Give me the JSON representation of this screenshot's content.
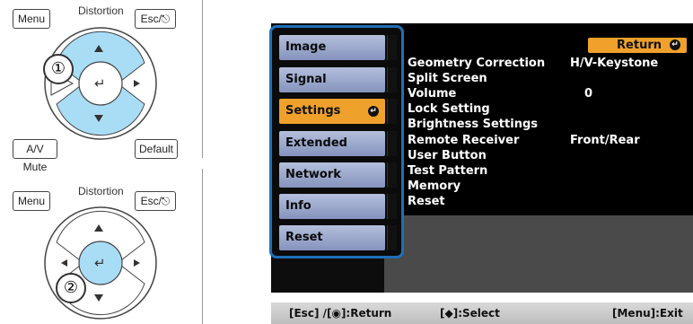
{
  "remote": {
    "menu_label": "Menu",
    "distortion_label": "Distortion",
    "esc_label": "Esc/⎋",
    "av_mute_label": "A/V Mute",
    "default_label": "Default",
    "step1": "①",
    "step2": "②"
  },
  "menu": {
    "items": [
      {
        "label": "Image"
      },
      {
        "label": "Signal"
      },
      {
        "label": "Settings"
      },
      {
        "label": "Extended"
      },
      {
        "label": "Network"
      },
      {
        "label": "Info"
      },
      {
        "label": "Reset"
      }
    ],
    "return_label": "Return",
    "settings": [
      {
        "label": "Geometry Correction",
        "value": "H/V-Keystone"
      },
      {
        "label": "Split Screen",
        "value": ""
      },
      {
        "label": "Volume",
        "value": "0"
      },
      {
        "label": "Lock Setting",
        "value": ""
      },
      {
        "label": "Brightness Settings",
        "value": ""
      },
      {
        "label": "Remote Receiver",
        "value": "Front/Rear"
      },
      {
        "label": "User Button",
        "value": ""
      },
      {
        "label": "Test Pattern",
        "value": ""
      },
      {
        "label": "Memory",
        "value": ""
      },
      {
        "label": "Reset",
        "value": ""
      }
    ]
  },
  "footer": {
    "left": "[Esc] /[◉]:Return",
    "middle": "[◆]:Select",
    "right": "[Menu]:Exit"
  },
  "colors": {
    "accent": "#f0a12b",
    "menu_border": "#1f6fb6"
  }
}
